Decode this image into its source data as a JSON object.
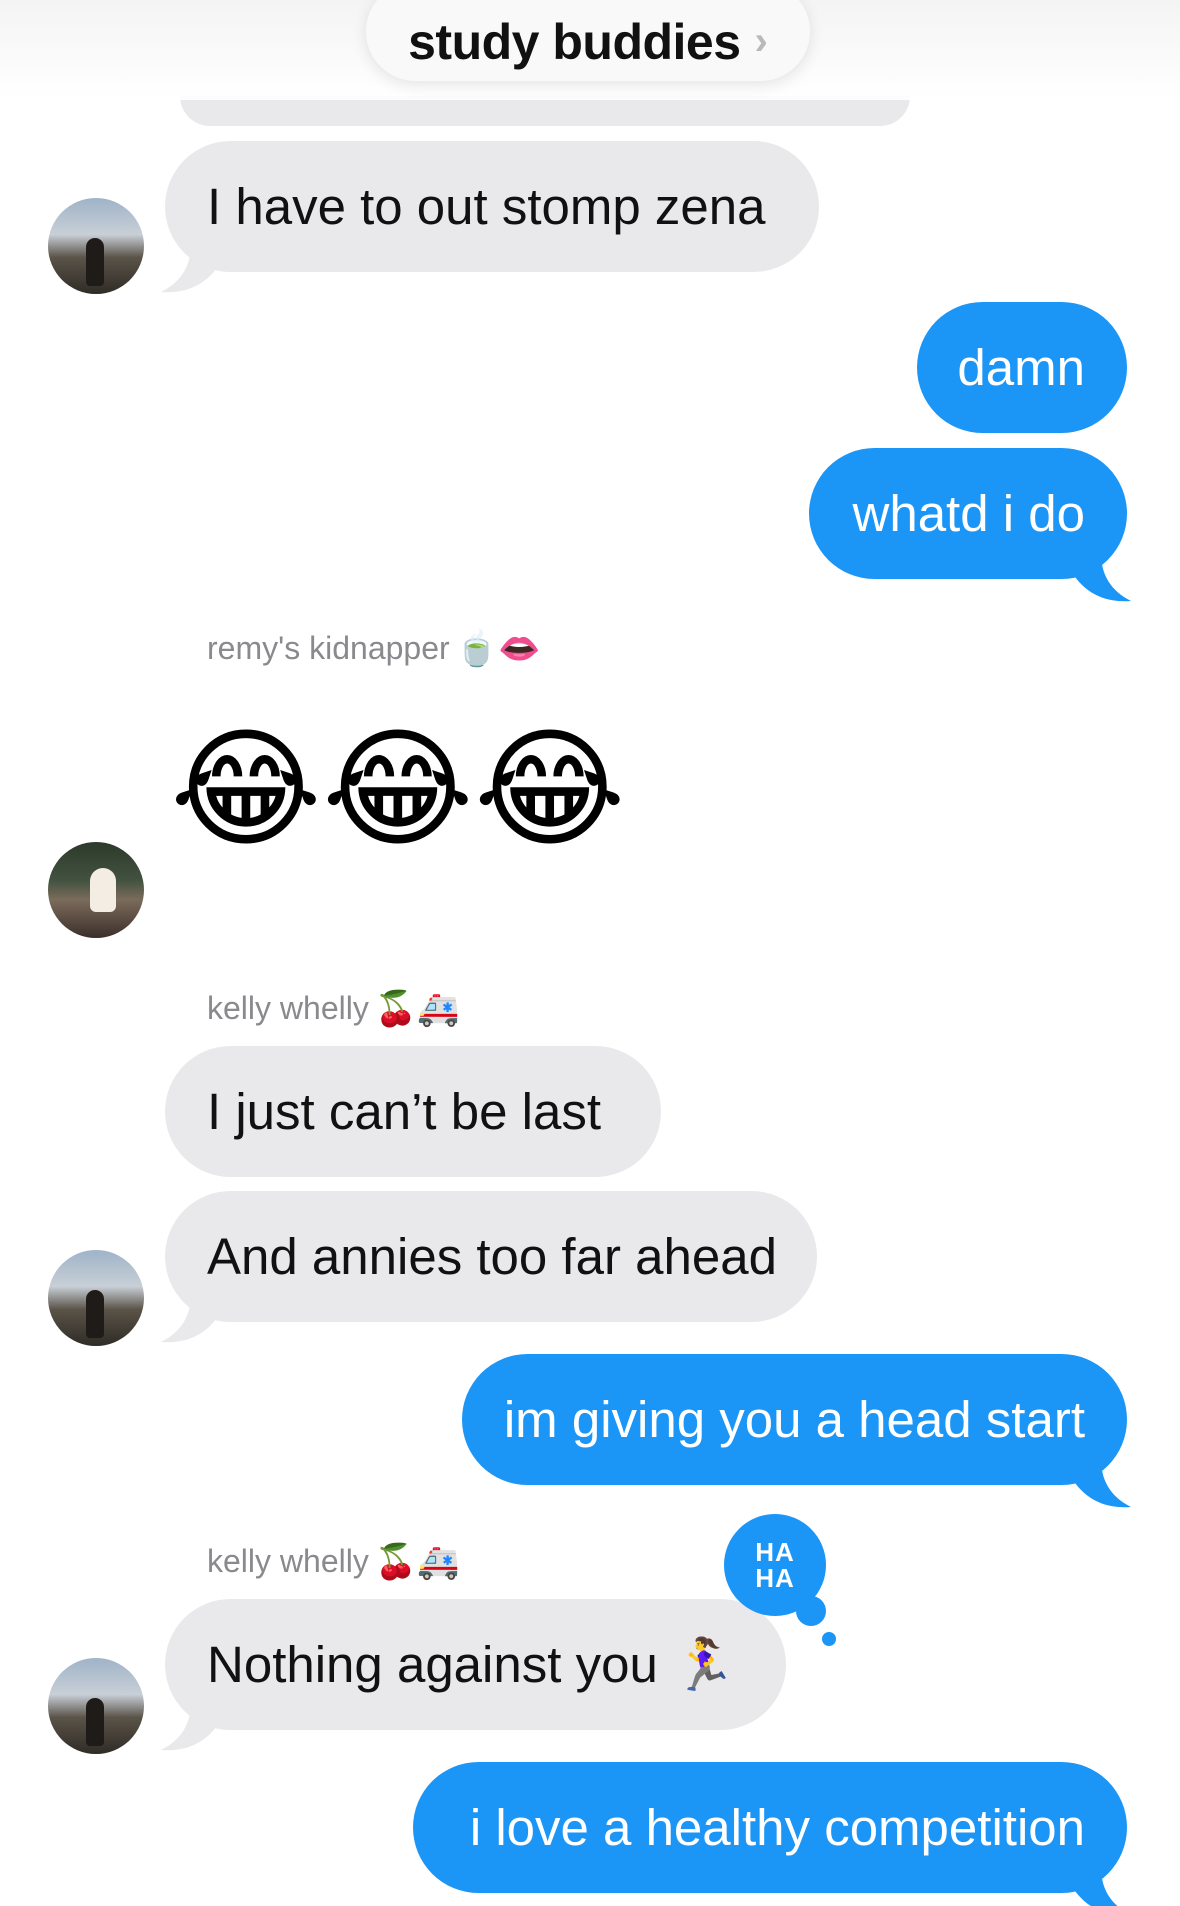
{
  "header": {
    "title": "study buddies",
    "chevron": "›"
  },
  "senders": {
    "remy": {
      "name": "remy's kidnapper",
      "emoji": "🍵👄"
    },
    "kelly": {
      "name": "kelly whelly",
      "emoji": "🍒🚑"
    }
  },
  "messages": [
    {
      "from": "them",
      "avatar": "dusk-avatar",
      "text": "I have to out stomp zena"
    },
    {
      "from": "me",
      "text": "damn"
    },
    {
      "from": "me",
      "text": "whatd i do"
    },
    {
      "from": "them",
      "sender": "remy's kidnapper",
      "avatar": "party-avatar",
      "text": "😂😂😂"
    },
    {
      "from": "them",
      "sender": "kelly whelly",
      "text": "I just can’t be last"
    },
    {
      "from": "them",
      "avatar": "dusk-avatar",
      "text": "And annies too far ahead"
    },
    {
      "from": "me",
      "text": "im giving you a head start"
    },
    {
      "from": "them",
      "sender": "kelly whelly",
      "avatar": "dusk-avatar",
      "text": "Nothing against you 🏃‍♀️",
      "tapback": "HA HA"
    },
    {
      "from": "me",
      "text": "i love a healthy competition"
    }
  ],
  "tapback": {
    "line1": "HA",
    "line2": "HA"
  },
  "colors": {
    "outgoing_bubble": "#1b96f7",
    "incoming_bubble": "#e9e9eb",
    "sender_name": "#8a8a8e"
  }
}
